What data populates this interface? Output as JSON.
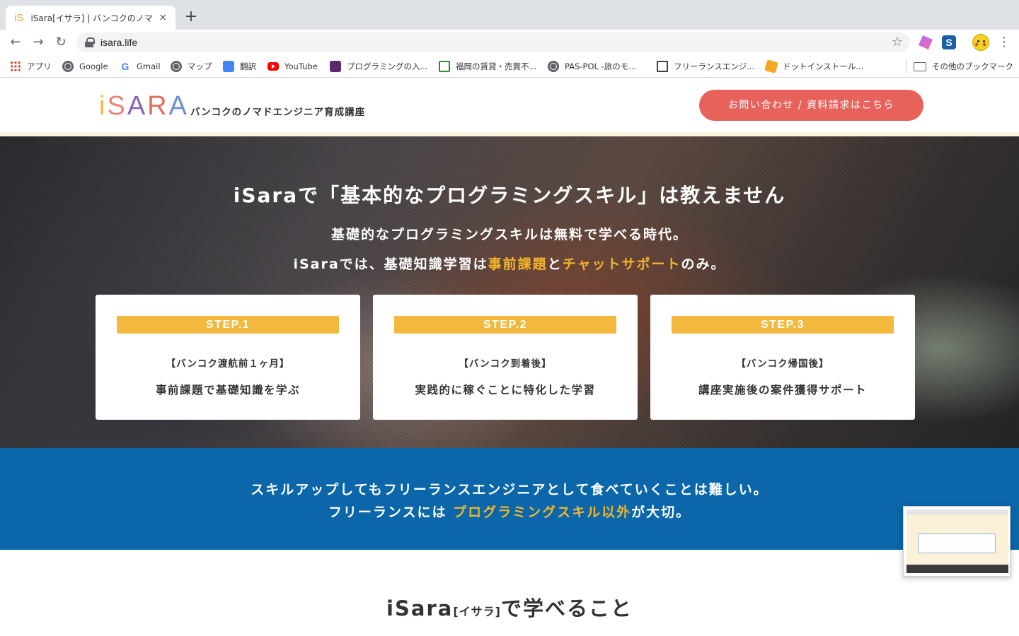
{
  "browser": {
    "tab_title": "iSara[イサラ] | バンコクのノマドエンジニア育成講座",
    "tab_close": "×",
    "new_tab": "+",
    "url": "isara.life",
    "nav": {
      "back": "←",
      "forward": "→",
      "reload": "↻"
    },
    "star": "☆",
    "menu": "⋮",
    "bookmarks": [
      {
        "label": "アプリ",
        "icon": "apps-icon"
      },
      {
        "label": "Google",
        "icon": "globe-icon"
      },
      {
        "label": "Gmail",
        "icon": "g-icon"
      },
      {
        "label": "マップ",
        "icon": "globe-icon"
      },
      {
        "label": "翻訳",
        "icon": "translate-icon"
      },
      {
        "label": "YouTube",
        "icon": "youtube-icon"
      },
      {
        "label": "プログラミングの入...",
        "icon": "prog-icon"
      },
      {
        "label": "福岡の賃貸・売買不...",
        "icon": "house-icon"
      },
      {
        "label": "PAS-POL -旅のモ...",
        "icon": "globe-icon"
      },
      {
        "label": "フリーランスエンジ...",
        "icon": "house-icon"
      },
      {
        "label": "ドットインストール...",
        "icon": "dotinstall-icon"
      },
      {
        "label": "その他のブックマーク",
        "icon": "folder-icon"
      }
    ]
  },
  "header": {
    "logo": "iSARA",
    "tagline": "バンコクのノマドエンジニア育成講座",
    "cta": "お問い合わせ / 資料請求はこちら"
  },
  "hero": {
    "title": "iSaraで「基本的なプログラミングスキル」は教えません",
    "line1": "基礎的なプログラミングスキルは無料で学べる時代。",
    "line2_prefix": "iSaraでは、基礎知識学習は",
    "line2_hl1": "事前課題",
    "line2_mid": "と",
    "line2_hl2": "チャットサポート",
    "line2_suffix": "のみ。",
    "steps": [
      {
        "badge": "STEP.1",
        "when": "【バンコク渡航前１ヶ月】",
        "what": "事前課題で基礎知識を学ぶ"
      },
      {
        "badge": "STEP.2",
        "when": "【バンコク到着後】",
        "what": "実践的に稼ぐことに特化した学習"
      },
      {
        "badge": "STEP.3",
        "when": "【バンコク帰国後】",
        "what": "講座実施後の案件獲得サポート"
      }
    ]
  },
  "band": {
    "line1": "スキルアップしてもフリーランスエンジニアとして食べていくことは難しい。",
    "line2_prefix": "フリーランスには ",
    "line2_hl": "プログラミングスキル以外",
    "line2_suffix": "が大切。"
  },
  "learn": {
    "heading_main": "iSara",
    "heading_small": "[イサラ]",
    "heading_suffix": "で学べること"
  },
  "colors": {
    "accent_yellow": "#f2b52f",
    "cta_red": "#e8625c",
    "band_blue": "#0b67a9"
  }
}
